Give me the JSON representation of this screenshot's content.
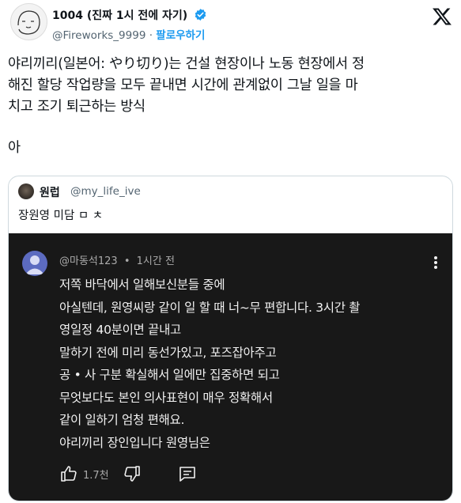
{
  "author": {
    "name": "1004 (진짜 1시 전에 자기)",
    "handle": "@Fireworks_9999",
    "separator": "·",
    "follow_label": "팔로우하기",
    "verified_color": "#1d9bf0"
  },
  "tweet": {
    "lines": [
      "야리끼리(일본어: やり切り)는 건설 현장이나 노동 현장에서 정",
      "해진 할당 작업량을 모두 끝내면 시간에 관계없이 그날 일을 마",
      "치고 조기 퇴근하는 방식"
    ],
    "extra": "아"
  },
  "quote": {
    "author_name": "원럽",
    "author_handle": "@my_life_ive",
    "text": "장원영 미담 ㅁ ㅊ"
  },
  "youtube_comment": {
    "author": "@마동석123",
    "dot": "•",
    "time": "1시간 전",
    "lines": [
      "저쪽 바닥에서 일해보신분들 중에",
      "아실텐데, 원영씨랑 같이 일 할 때 너~무 편합니다. 3시간 촬",
      "영일정 40분이면 끝내고",
      "말하기 전에 미리 동선가있고, 포즈잡아주고",
      "공 • 사 구분 확실해서 일에만 집중하면 되고",
      "무엇보다도 본인 의사표현이 매우 정확해서",
      "같이 일하기 엄청 편해요.",
      "야리끼리 장인입니다 원영님은"
    ],
    "like_count": "1.7천",
    "avatar_color": "#5c6bc0"
  },
  "icons": [
    "verified-badge-icon",
    "x-logo-icon",
    "more-vert-icon",
    "thumbs-up-icon",
    "thumbs-down-icon",
    "reply-icon"
  ]
}
